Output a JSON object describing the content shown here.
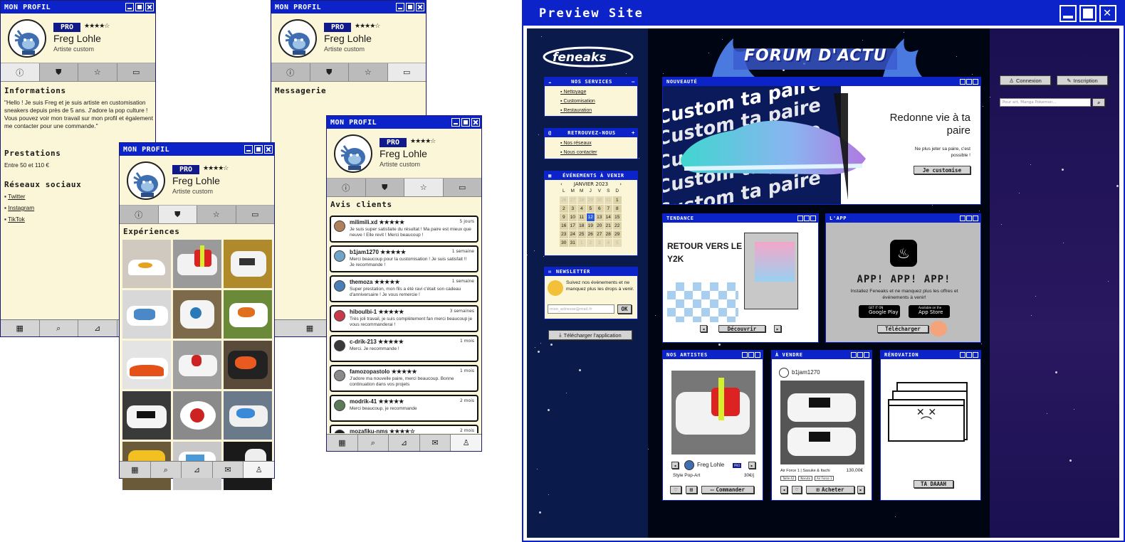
{
  "profile": {
    "window_title": "MON PROFIL",
    "badge": "PRO",
    "stars": "★★★★☆",
    "name": "Freg Lohle",
    "subtitle": "Artiste custom"
  },
  "info_panel": {
    "section_info": "Informations",
    "bio": "\"Hello ! Je suis Freg et je suis artiste en customisation sneakers depuis près de 5 ans. J'adore la pop culture !\nVous pouvez voir mon travail sur mon profil et également me contacter pour une commande.\"",
    "section_services": "Prestations",
    "price_range": "Entre 50 et 110 €",
    "section_social": "Réseaux sociaux",
    "social_links": [
      "Twitter",
      "Instagram",
      "TikTok"
    ]
  },
  "messaging_panel": {
    "section_title": "Messagerie"
  },
  "experience_panel": {
    "section_title": "Expériences"
  },
  "reviews_panel": {
    "section_title": "Avis clients",
    "reviews": [
      {
        "user": "milimili.xd",
        "stars": "★★★★★",
        "time": "5 jours",
        "text": "Je suis super satisfaite du résultat ! Ma paire est mieux que neuve ! Elle revit ! Merci beaucoup !",
        "color": "#b0805a"
      },
      {
        "user": "b1jam1270",
        "stars": "★★★★★",
        "time": "1 semaine",
        "text": "Merci beaucoup pour la customisation ! Je suis satisfait !! Je recommande !",
        "color": "#6fa3c8"
      },
      {
        "user": "themoza",
        "stars": "★★★★★",
        "time": "1 semaine",
        "text": "Super prestation, mon fils a été ravi c'était son cadeau d'anniversaire ! Je vous remercie !",
        "color": "#4a7fb5"
      },
      {
        "user": "hiboulbi-1",
        "stars": "★★★★★",
        "time": "3 semaines",
        "text": "Très joli travail, je suis complètement fan merci beaucoup je vous recommanderai !",
        "color": "#c83a4a"
      },
      {
        "user": "c-drik-213",
        "stars": "★★★★★",
        "time": "1 mois",
        "text": "Merci. Je recommande !",
        "color": "#3a3a3a"
      },
      {
        "user": "famozopastolo",
        "stars": "★★★★★",
        "time": "1 mois",
        "text": "J'adore ma nouvelle paire, merci beaucoup. Bonne continuation dans vos projets",
        "color": "#8a8a8a"
      },
      {
        "user": "modrik-41",
        "stars": "★★★★★",
        "time": "2 mois",
        "text": "Merci beaucoup, je recommande",
        "color": "#5a7a5a"
      },
      {
        "user": "mozafiku-nms",
        "stars": "★★★★☆",
        "time": "2 mois",
        "text": "",
        "color": "#222"
      }
    ]
  },
  "preview": {
    "window_title": "Preview Site",
    "banner_title": "FORUM D'ACTU",
    "services": {
      "title": "NOS SERVICES",
      "items": [
        "Nettoyage",
        "Customisation",
        "Restauration"
      ]
    },
    "find_us": {
      "title": "RETROUVEZ-NOUS",
      "items": [
        "Nos réseaux",
        "Nous contacter"
      ]
    },
    "events": {
      "title": "ÉVÉNEMENTS À VENIR",
      "month": "JANVIER 2023",
      "weekdays": [
        "L",
        "M",
        "M",
        "J",
        "V",
        "S",
        "D"
      ],
      "weeks": [
        [
          "26",
          "27",
          "28",
          "29",
          "30",
          "31",
          "1"
        ],
        [
          "2",
          "3",
          "4",
          "5",
          "6",
          "7",
          "8"
        ],
        [
          "9",
          "10",
          "11",
          "12",
          "13",
          "14",
          "15"
        ],
        [
          "16",
          "17",
          "18",
          "19",
          "20",
          "21",
          "22"
        ],
        [
          "23",
          "24",
          "25",
          "26",
          "27",
          "28",
          "29"
        ],
        [
          "30",
          "31",
          "1",
          "2",
          "3",
          "4",
          "5"
        ]
      ]
    },
    "newsletter": {
      "title": "NEWSLETTER",
      "text": "Suivez nos évènements et ne manquez plus les drops à venir.",
      "placeholder": "mon_adresse@mail.fr",
      "ok": "OK"
    },
    "download_app": "Télécharger l'application",
    "nouveaute": {
      "title": "NOUVEAUTÉ",
      "headline": "Redonne vie à ta paire",
      "text": "Ne plus jeter sa paire, c'est possible !",
      "cta": "Je customise",
      "bg_word": "Custom ta paire"
    },
    "tendance": {
      "title": "TENDANCE",
      "headline": "RETOUR VERS LE Y2K",
      "cta": "Découvrir"
    },
    "app": {
      "title": "L'APP",
      "headline": "APP! APP! APP!",
      "text": "Installez Feneaks et ne manquez plus les offres et événements à venir!",
      "google": "Google Play",
      "google_small": "GET IT ON",
      "apple": "App Store",
      "apple_small": "Available on the",
      "cta": "Télécharger"
    },
    "artists": {
      "title": "NOS ARTISTES",
      "name": "Freg Lohle",
      "badge": "PRO",
      "style": "Style Pop-Art",
      "price": "30€/j",
      "cta": "Commander"
    },
    "sale": {
      "title": "À VENDRE",
      "seller": "b1jam1270",
      "item": "Air Force 1 | Sasuke & Itachi",
      "price": "130,00€",
      "tags": [
        "Taille 42",
        "Naruto",
        "Air Force 1"
      ],
      "cta": "Acheter"
    },
    "renovation": {
      "title": "RÉNOVATION",
      "cta": "TA DAAAH"
    },
    "auth": {
      "login": "Connexion",
      "signup": "Inscription",
      "search_placeholder": "Pour art, Manga Pokemon..."
    }
  },
  "colors": {
    "window_blue": "#0b23c9",
    "cream": "#fcf6d8",
    "night": "#000514"
  }
}
